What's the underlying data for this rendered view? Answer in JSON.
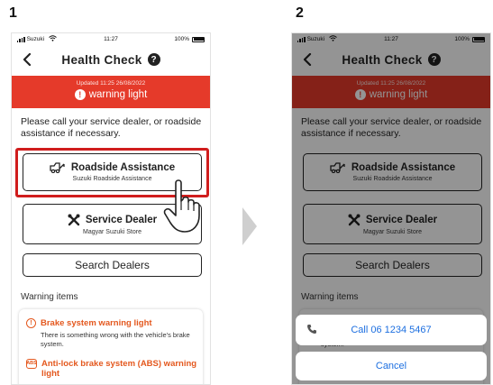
{
  "steps": [
    "1",
    "2"
  ],
  "status": {
    "carrier": "Suzuki",
    "time": "11:27",
    "battery": "100%"
  },
  "header": {
    "title": "Health Check",
    "help": "?"
  },
  "alert": {
    "updated": "Updated 11:25 26/08/2022",
    "label": "warning light",
    "icon": "!"
  },
  "message": "Please call your service dealer, or roadside assistance if necessary.",
  "roadside": {
    "label": "Roadside Assistance",
    "sub": "Suzuki Roadside Assistance"
  },
  "dealer": {
    "label": "Service Dealer",
    "sub": "Magyar Suzuki Store"
  },
  "search": {
    "label": "Search Dealers"
  },
  "warnings": {
    "section_title": "Warning items",
    "items": [
      {
        "title": "Brake system warning light",
        "desc": "There is something wrong with the vehicle's brake system.",
        "icon": "!"
      },
      {
        "title": "Anti-lock brake system (ABS) warning light",
        "icon": "ABS"
      }
    ]
  },
  "sheet": {
    "call_label": "Call 06 1234 5467",
    "cancel_label": "Cancel"
  },
  "colors": {
    "alert_red": "#e53a2a",
    "warning_orange": "#e4581e",
    "highlight_red": "#d01d1d",
    "ios_blue": "#1d6fe0"
  },
  "icons": [
    "back-icon",
    "help-icon",
    "exclamation-icon",
    "tow-truck-icon",
    "tools-icon",
    "brake-warning-icon",
    "abs-warning-icon",
    "tap-hand-icon",
    "chevron-right-icon",
    "phone-icon",
    "wifi-icon",
    "battery-icon",
    "signal-icon"
  ]
}
